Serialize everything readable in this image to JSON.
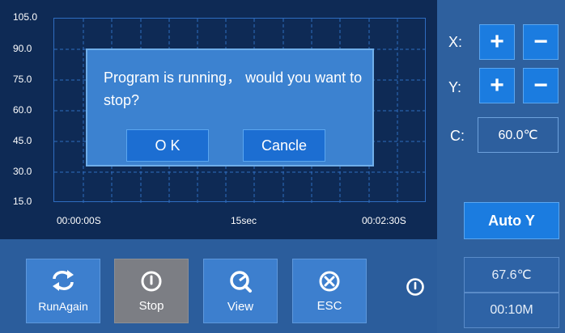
{
  "chart": {
    "y_ticks": [
      "105.0",
      "90.0",
      "75.0",
      "60.0",
      "45.0",
      "30.0",
      "15.0"
    ],
    "x_ticks": [
      "00:00:00S",
      "15sec",
      "00:02:30S"
    ]
  },
  "chart_data": {
    "type": "line",
    "title": "",
    "xlabel": "",
    "ylabel": "",
    "ylim": [
      15.0,
      105.0
    ],
    "x_ticks": [
      "00:00:00S",
      "15sec",
      "00:02:30S"
    ],
    "y_ticks": [
      "105.0",
      "90.0",
      "75.0",
      "60.0",
      "45.0",
      "30.0",
      "15.0"
    ],
    "series": [],
    "grid": true
  },
  "dialog": {
    "message": "Program is running， would you want to stop?",
    "ok_label": "O K",
    "cancel_label": "Cancle"
  },
  "controls": {
    "x_label": "X:",
    "y_label": "Y:",
    "c_label": "C:",
    "plus": "+",
    "minus": "−",
    "c_value": "60.0℃",
    "auto_y_label": "Auto Y",
    "temperature": "67.6℃",
    "time": "00:10M"
  },
  "toolbar": {
    "run_again_label": "RunAgain",
    "stop_label": "Stop",
    "view_label": "View",
    "esc_label": "ESC"
  },
  "colors": {
    "background": "#2b5d9c",
    "chart_bg": "#0e2a55",
    "accent_button": "#1b7ce0",
    "dialog_bg": "#3c82d0",
    "stop_button": "#7c7e84"
  }
}
